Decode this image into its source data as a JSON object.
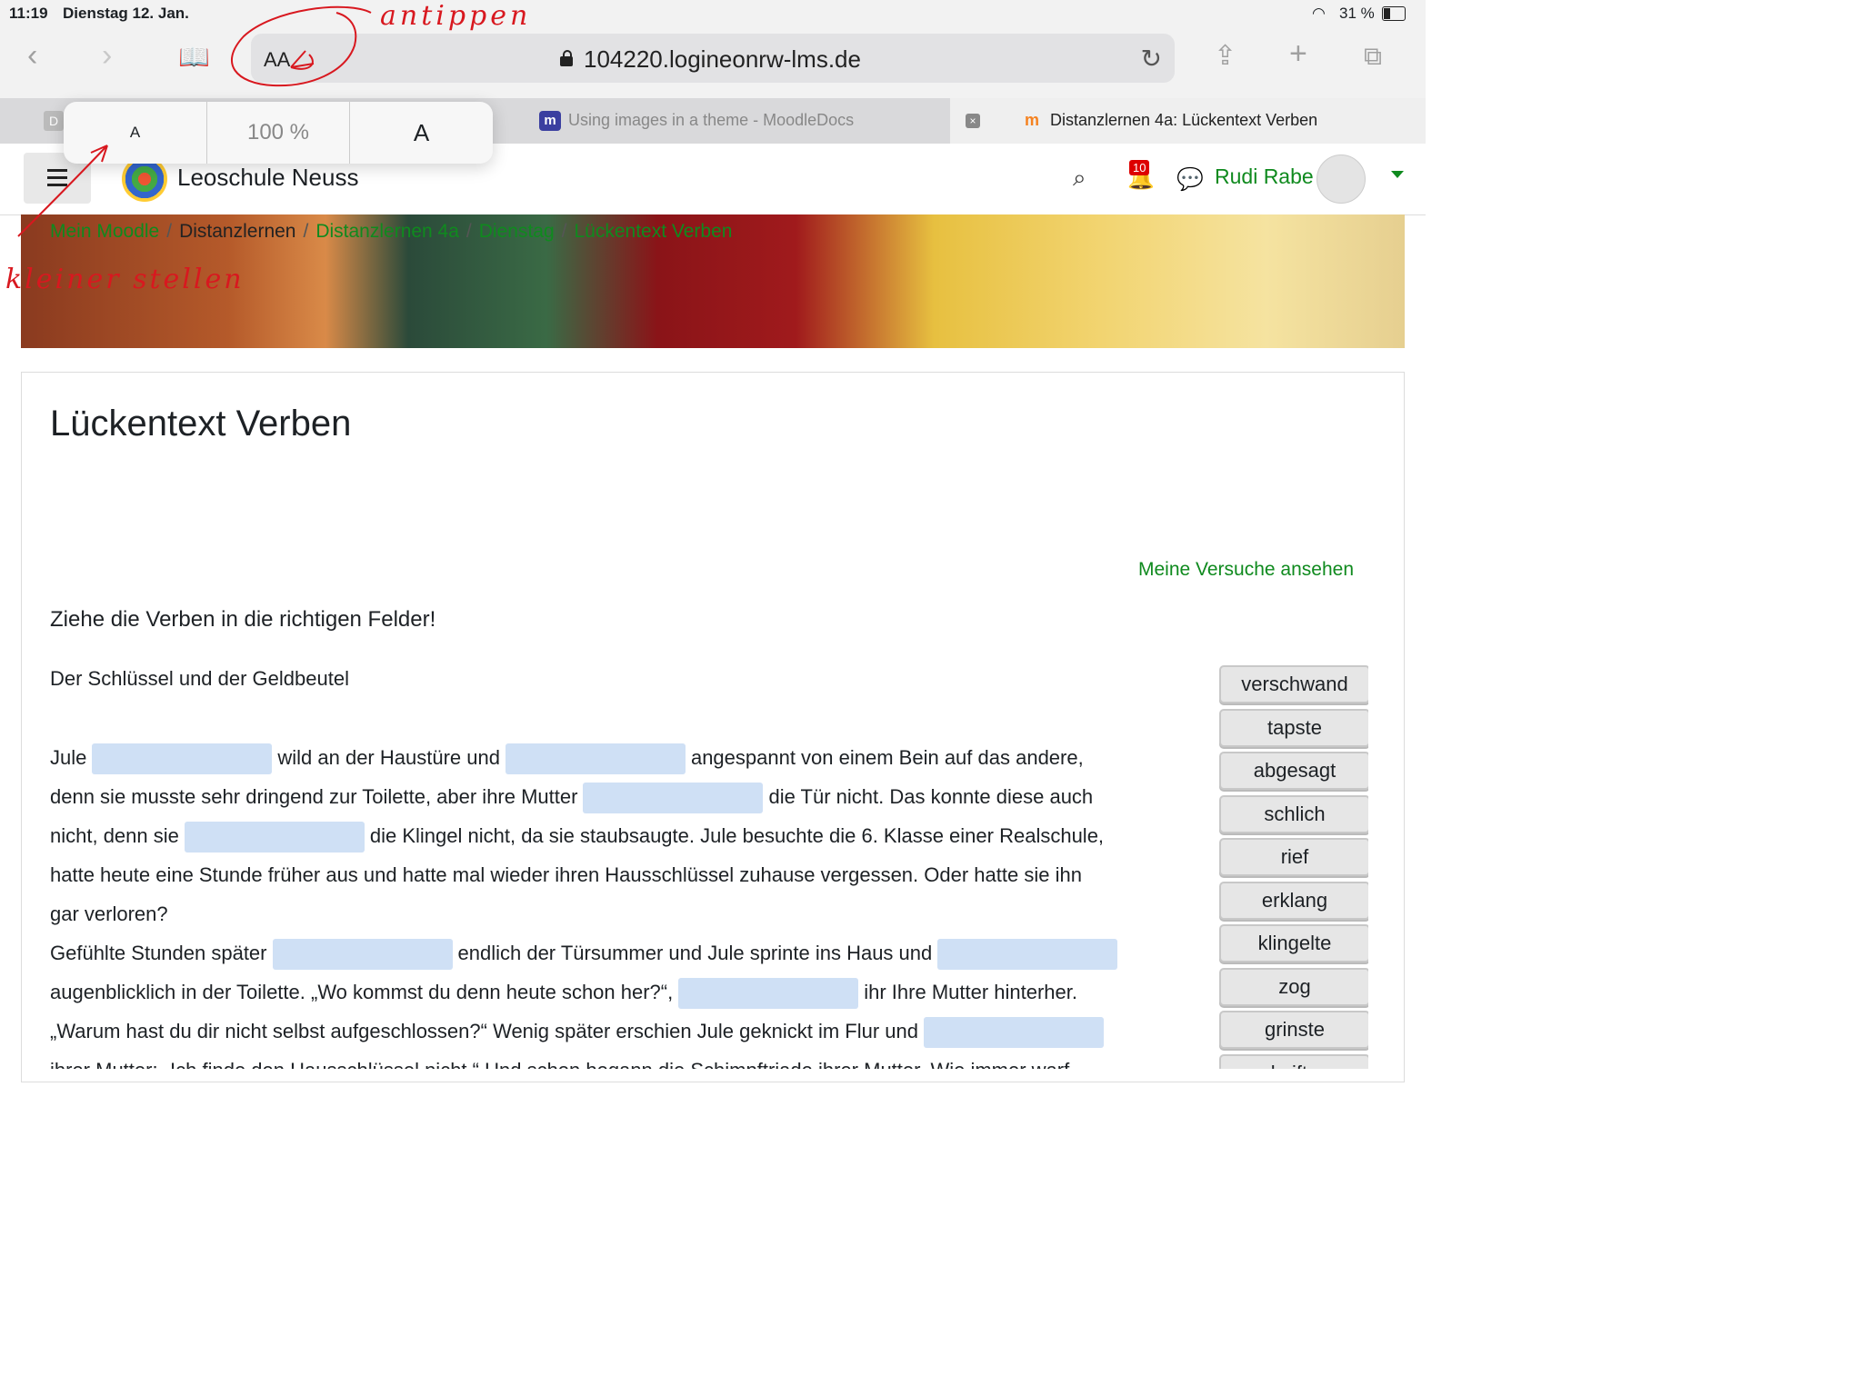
{
  "status": {
    "time": "11:19",
    "date": "Dienstag 12. Jan.",
    "battery": "31 %"
  },
  "browser": {
    "url": "104220.logineonrw-lms.de",
    "aa_label": "AA",
    "zoom_popover": {
      "smaller": "A",
      "zoom": "100 %",
      "larger": "A"
    },
    "tabs": [
      {
        "label": "D"
      },
      {
        "label": "Using images in a theme - MoodleDocs"
      },
      {
        "label": "Distanzlernen 4a: Lückentext Verben"
      }
    ]
  },
  "navbar": {
    "school": "Leoschule Neuss",
    "notification_count": "10",
    "user": "Rudi Rabe"
  },
  "breadcrumb": [
    "Mein Moodle",
    "Distanzlernen",
    "Distanzlernen 4a",
    "Dienstag",
    "Lückentext Verben"
  ],
  "page": {
    "title": "Lückentext Verben",
    "attempts_link": "Meine Versuche ansehen",
    "instruction": "Ziehe die Verben in die richtigen Felder!",
    "story_title": "Der Schlüssel und der Geldbeutel",
    "text": {
      "l1a": "Jule",
      "l1b": "wild an der Haustüre und",
      "l1c": "angespannt von einem Bein auf das andere,",
      "l2a": "denn sie musste sehr dringend zur Toilette, aber ihre Mutter",
      "l2b": "die Tür nicht. Das konnte diese auch",
      "l3a": "nicht, denn sie",
      "l3b": "die Klingel nicht, da sie staubsaugte. Jule besuchte die 6. Klasse einer Realschule,",
      "l4": "hatte heute eine Stunde früher aus und hatte mal wieder ihren Hausschlüssel zuhause vergessen. Oder hatte sie ihn",
      "l5": "gar verloren?",
      "l6a": "Gefühlte Stunden später",
      "l6b": "endlich der Türsummer und Jule sprinte ins Haus und",
      "l7a": "augenblicklich in der Toilette. „Wo kommst du denn heute schon her?“,",
      "l7b": "ihr Ihre Mutter hinterher.",
      "l8": "„Warum hast du dir nicht selbst aufgeschlossen?“ Wenig später erschien Jule geknickt im Flur und",
      "l9": "ihrer Mutter: „Ich finde den Hausschlüssel nicht.“ Und schon begann die Schimpftriade ihrer Mutter. Wie immer warf"
    },
    "verbs": [
      "verschwand",
      "tapste",
      "abgesagt",
      "schlich",
      "rief",
      "erklang",
      "klingelte",
      "zog",
      "grinste",
      "keifte"
    ]
  },
  "annotations": {
    "tap": "antippen",
    "smaller": "kleiner stellen"
  },
  "colors": {
    "accent_green": "#0f8a1e",
    "gap_fill": "#cfe0f5",
    "annotation_red": "#d8181f"
  }
}
